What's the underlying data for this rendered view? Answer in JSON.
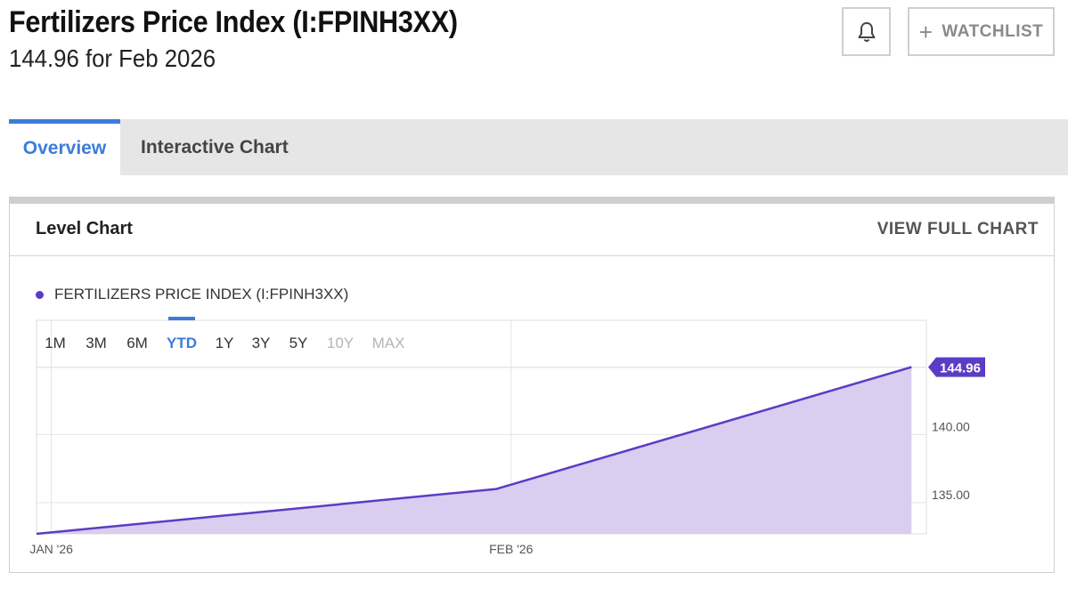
{
  "header": {
    "title": "Fertilizers Price Index (I:FPINH3XX)",
    "subtitle": "144.96 for Feb 2026",
    "watchlist_label": "WATCHLIST"
  },
  "tabs": [
    {
      "label": "Overview",
      "active": true
    },
    {
      "label": "Interactive Chart",
      "active": false
    }
  ],
  "panel": {
    "title": "Level Chart",
    "view_full_label": "VIEW FULL CHART"
  },
  "colors": {
    "accent_blue": "#3b7dd8",
    "series_purple": "#5b3cc4",
    "area_fill": "#d9cdf0"
  },
  "range_buttons": [
    {
      "label": "1M",
      "state": "enabled"
    },
    {
      "label": "3M",
      "state": "enabled"
    },
    {
      "label": "6M",
      "state": "enabled"
    },
    {
      "label": "YTD",
      "state": "active"
    },
    {
      "label": "1Y",
      "state": "enabled"
    },
    {
      "label": "3Y",
      "state": "enabled"
    },
    {
      "label": "5Y",
      "state": "enabled"
    },
    {
      "label": "10Y",
      "state": "disabled"
    },
    {
      "label": "MAX",
      "state": "disabled"
    }
  ],
  "chart_data": {
    "type": "area",
    "series": [
      {
        "name": "FERTILIZERS PRICE INDEX (I:FPINH3XX)",
        "points": [
          {
            "x": "2025-12-31",
            "y": 132.7
          },
          {
            "x": "2026-01-31",
            "y": 136.0
          },
          {
            "x": "2026-02-28",
            "y": 144.96
          }
        ]
      }
    ],
    "x_ticks": [
      {
        "date": "2026-01-01",
        "label": "JAN '26"
      },
      {
        "date": "2026-02-01",
        "label": "FEB '26"
      }
    ],
    "y_ticks": [
      {
        "value": 135,
        "label": "135.00"
      },
      {
        "value": 140,
        "label": "140.00"
      }
    ],
    "last_value_label": "144.96",
    "ylim": [
      132.7,
      148.4
    ],
    "xlim": [
      "2025-12-31",
      "2026-03-01"
    ],
    "grid": true,
    "legend": "top-left"
  }
}
